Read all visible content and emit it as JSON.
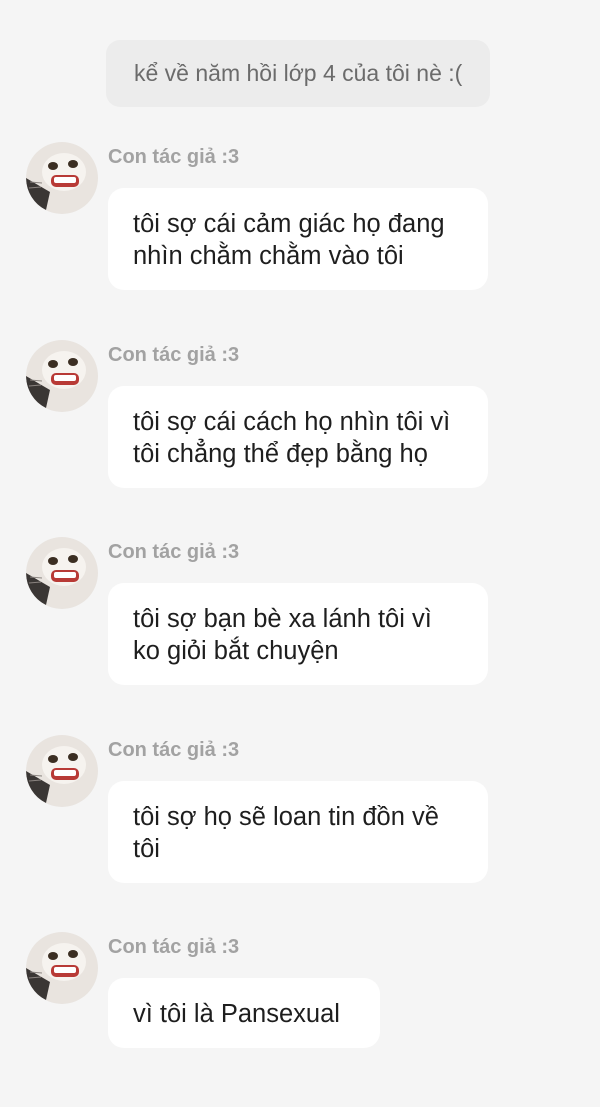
{
  "system_message": "kể về năm hồi lớp 4 của tôi nè :(",
  "messages": [
    {
      "sender": "Con tác giả :3",
      "text": "tôi sợ cái cảm giác họ đang nhìn chằm chằm vào tôi"
    },
    {
      "sender": "Con tác giả :3",
      "text": "tôi sợ cái cách họ nhìn tôi vì tôi chẳng thể đẹp bằng họ"
    },
    {
      "sender": "Con tác giả :3",
      "text": "tôi sợ bạn bè xa lánh tôi vì ko giỏi bắt chuyện"
    },
    {
      "sender": "Con tác giả :3",
      "text": "tôi sợ họ sẽ loan tin đồn về tôi"
    },
    {
      "sender": "Con tác giả :3",
      "text": "vì tôi là Pansexual"
    }
  ],
  "avatar_icon": "cat-face-avatar-icon"
}
